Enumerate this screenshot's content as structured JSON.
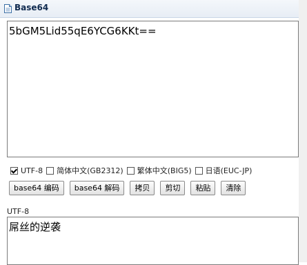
{
  "header": {
    "title": "Base64",
    "icon": "document-icon"
  },
  "input": {
    "value": "5bGM5Lid55qE6YCG6KKt=="
  },
  "encodings": [
    {
      "label": "UTF-8",
      "checked": true
    },
    {
      "label": "简体中文(GB2312)",
      "checked": false
    },
    {
      "label": "繁体中文(BIG5)",
      "checked": false
    },
    {
      "label": "日语(EUC-JP)",
      "checked": false
    }
  ],
  "buttons": {
    "encode": "base64 编码",
    "decode": "base64 解码",
    "copy": "拷贝",
    "cut": "剪切",
    "paste": "粘贴",
    "clear": "清除"
  },
  "output": {
    "label": "UTF-8",
    "value": "屌丝的逆袭"
  }
}
